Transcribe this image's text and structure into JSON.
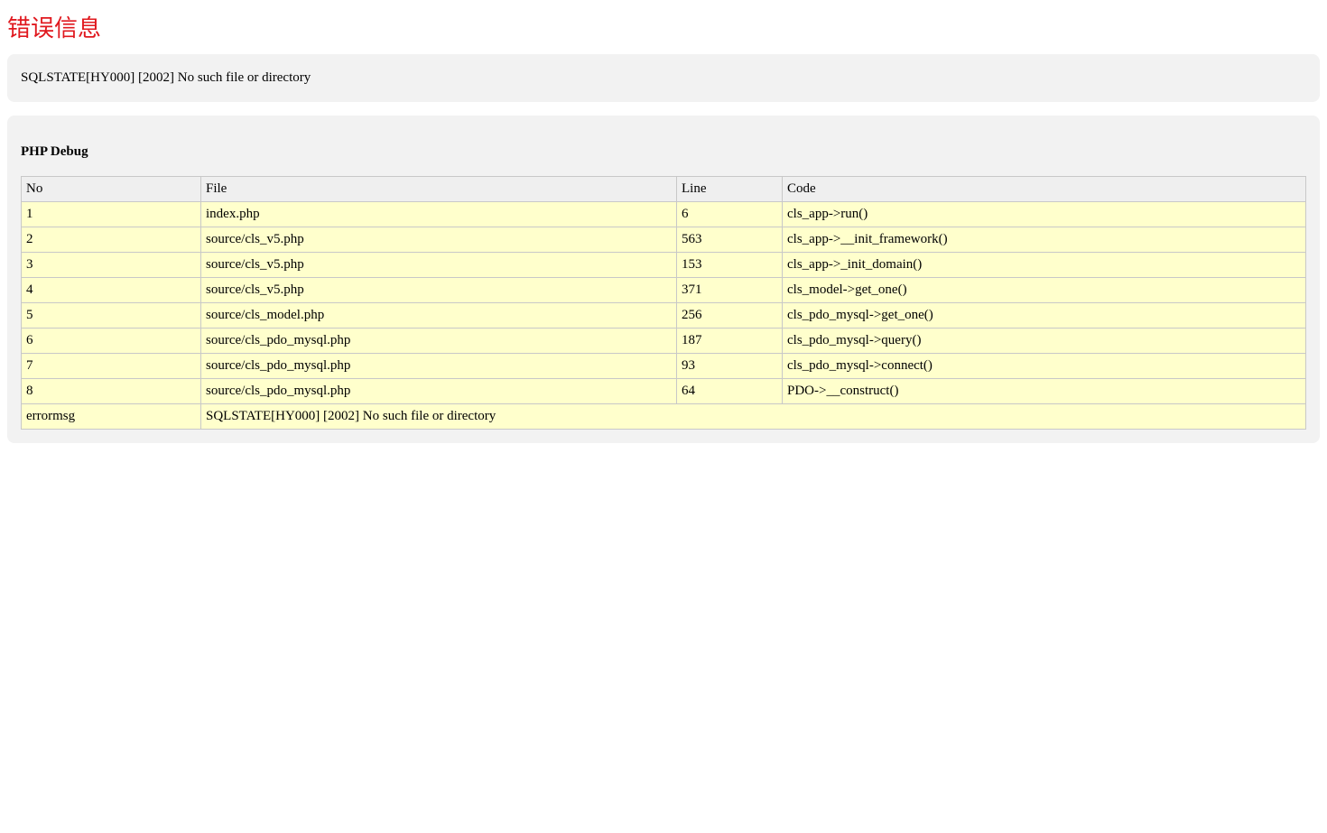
{
  "page": {
    "title": "错误信息",
    "error_message": "SQLSTATE[HY000] [2002] No such file or directory"
  },
  "debug": {
    "heading": "PHP Debug",
    "columns": [
      "No",
      "File",
      "Line",
      "Code"
    ],
    "rows": [
      {
        "no": "1",
        "file": "index.php",
        "line": "6",
        "code": "cls_app->run()"
      },
      {
        "no": "2",
        "file": "source/cls_v5.php",
        "line": "563",
        "code": "cls_app->__init_framework()"
      },
      {
        "no": "3",
        "file": "source/cls_v5.php",
        "line": "153",
        "code": "cls_app->_init_domain()"
      },
      {
        "no": "4",
        "file": "source/cls_v5.php",
        "line": "371",
        "code": "cls_model->get_one()"
      },
      {
        "no": "5",
        "file": "source/cls_model.php",
        "line": "256",
        "code": "cls_pdo_mysql->get_one()"
      },
      {
        "no": "6",
        "file": "source/cls_pdo_mysql.php",
        "line": "187",
        "code": "cls_pdo_mysql->query()"
      },
      {
        "no": "7",
        "file": "source/cls_pdo_mysql.php",
        "line": "93",
        "code": "cls_pdo_mysql->connect()"
      },
      {
        "no": "8",
        "file": "source/cls_pdo_mysql.php",
        "line": "64",
        "code": "PDO->__construct()"
      }
    ],
    "errormsg_label": "errormsg",
    "errormsg_value": "SQLSTATE[HY000] [2002] No such file or directory"
  },
  "colors": {
    "title": "#e0181e",
    "box_bg": "#f2f2f2",
    "header_bg": "#efefef",
    "row_bg": "#ffffcc"
  }
}
